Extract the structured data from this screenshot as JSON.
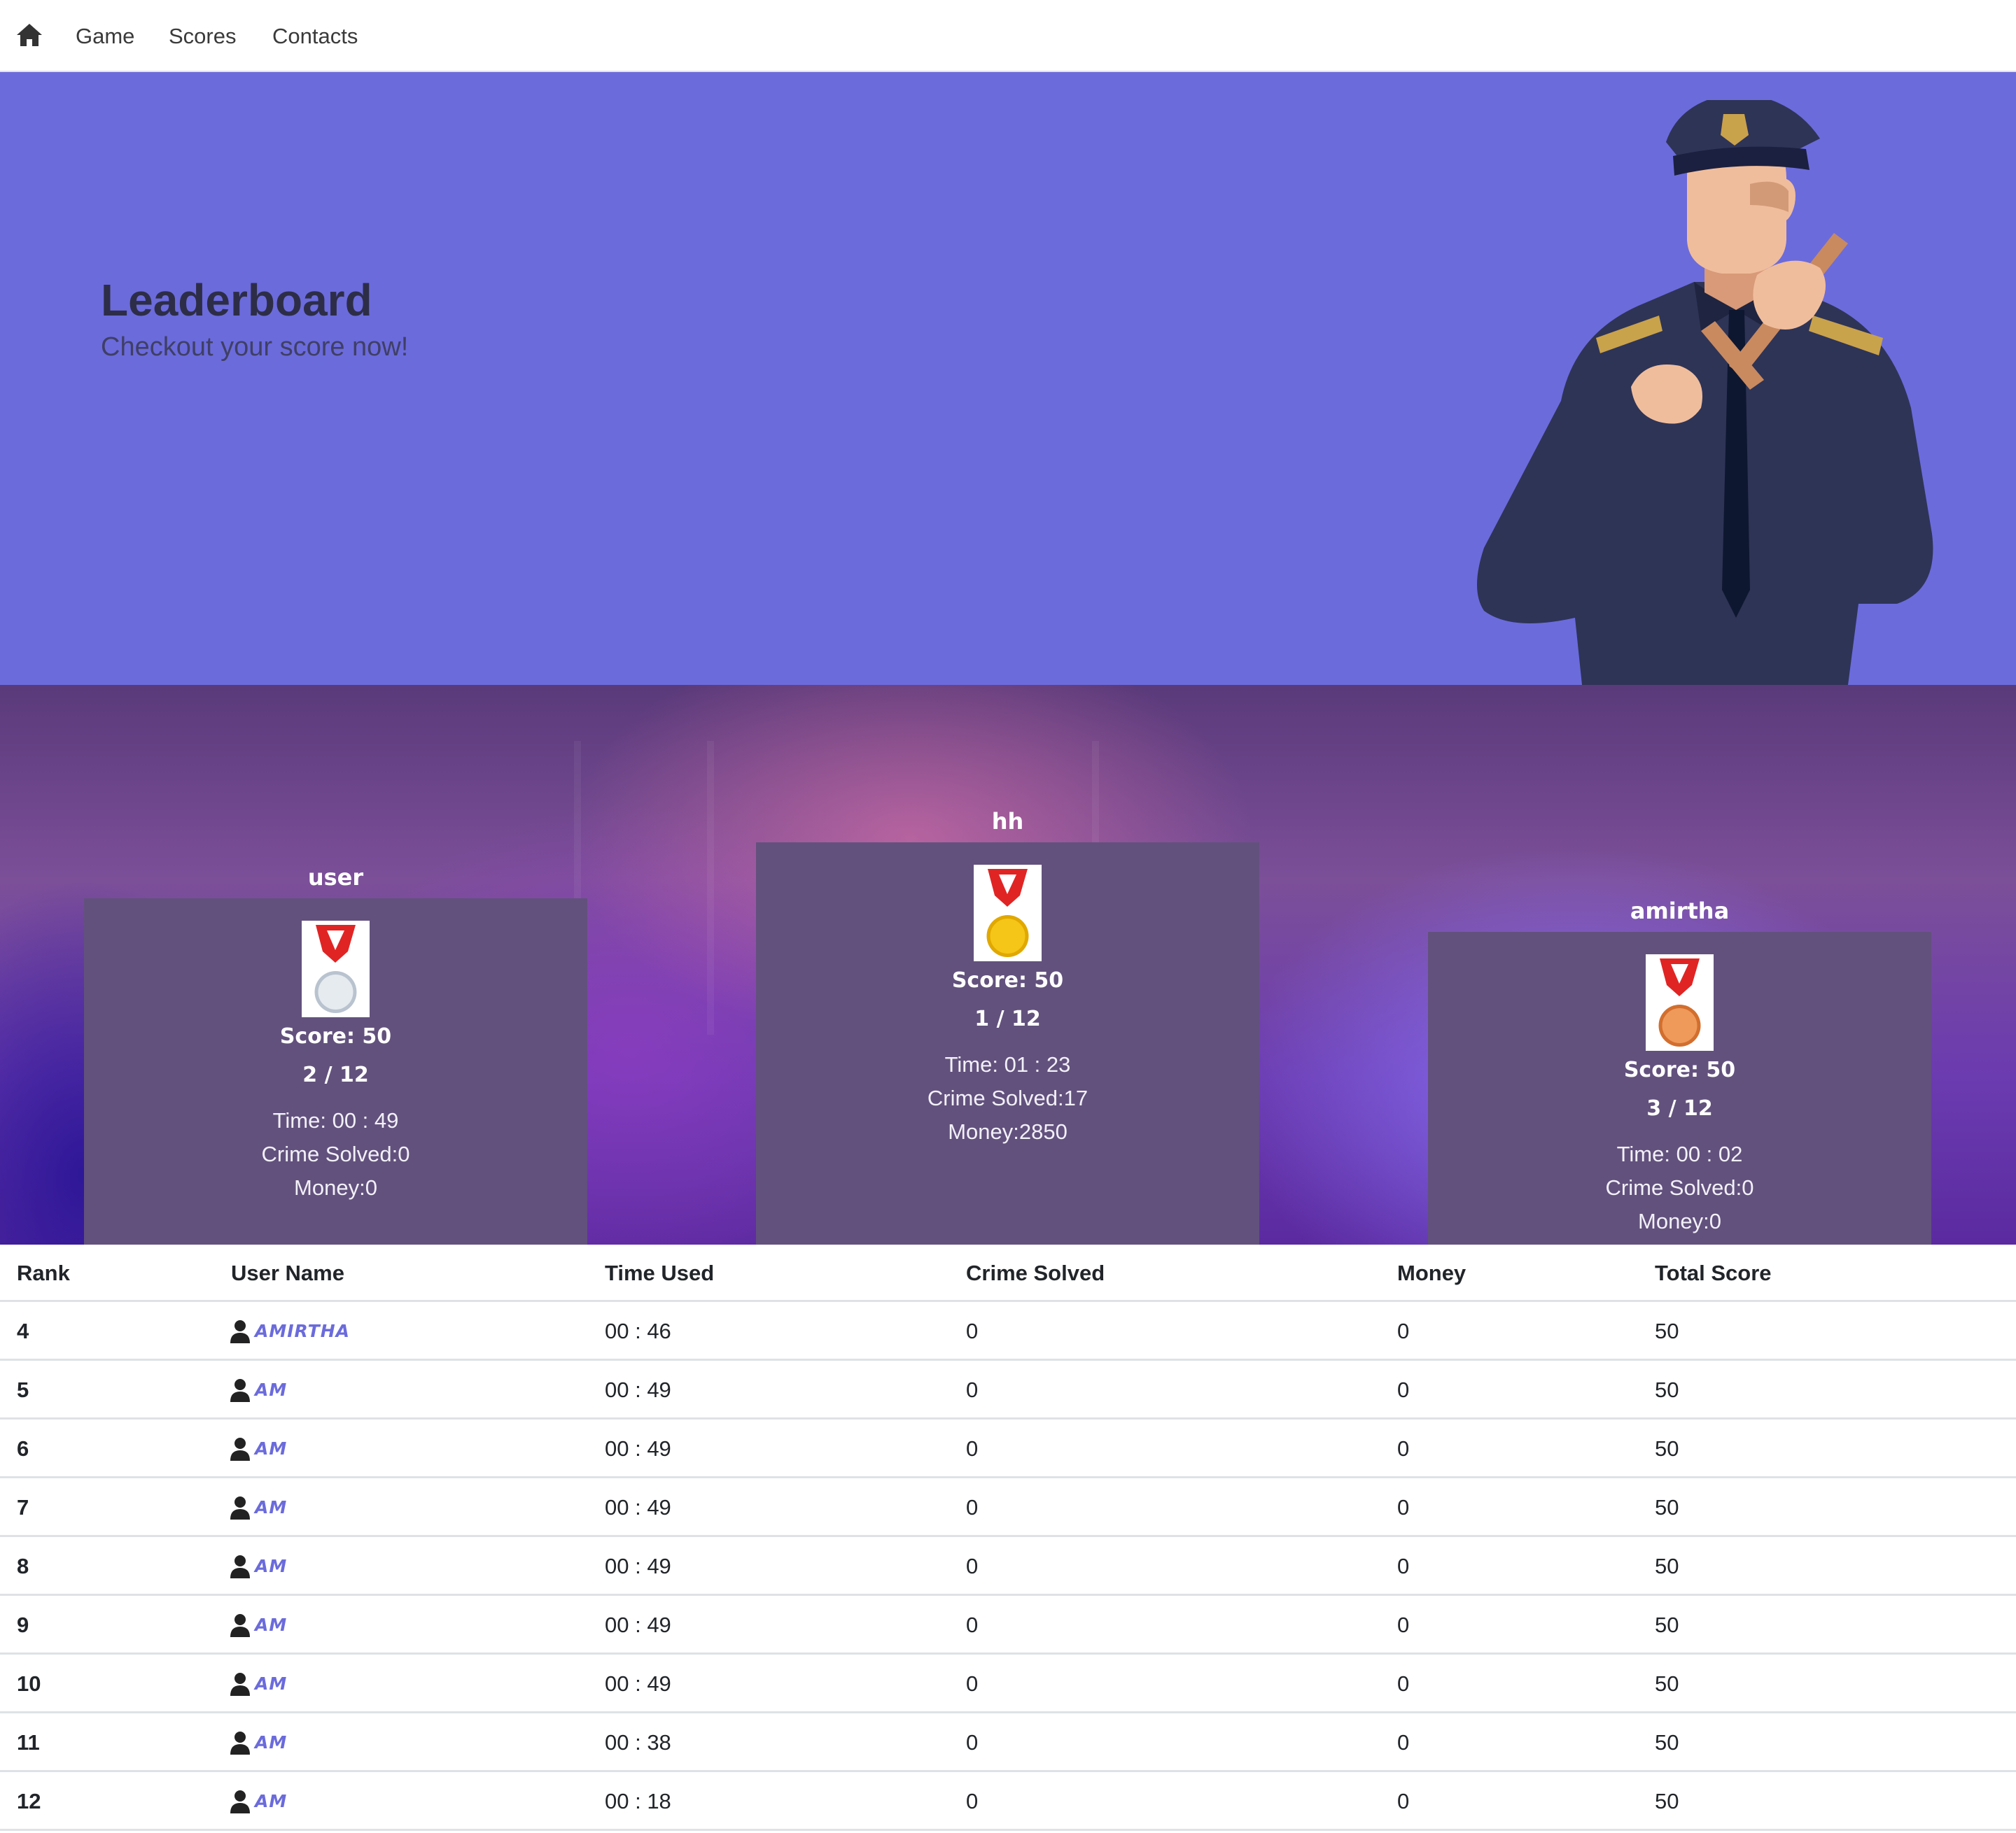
{
  "nav": {
    "home_icon": "home-icon",
    "links": [
      "Game",
      "Scores",
      "Contacts"
    ]
  },
  "hero": {
    "title": "Leaderboard",
    "subtitle": "Checkout your score now!",
    "illustration": "police-officer-illustration",
    "background": "#6b6bdc"
  },
  "podium": [
    {
      "name": "user",
      "medal": "silver-medal-icon",
      "score": "Score: 50",
      "rank": "2 / 12",
      "time": "Time: 00 : 49",
      "crime": "Crime Solved:0",
      "money": "Money:0"
    },
    {
      "name": "hh",
      "medal": "gold-medal-icon",
      "score": "Score: 50",
      "rank": "1 / 12",
      "time": "Time: 01 : 23",
      "crime": "Crime Solved:17",
      "money": "Money:2850"
    },
    {
      "name": "amirtha",
      "medal": "bronze-medal-icon",
      "score": "Score: 50",
      "rank": "3 / 12",
      "time": "Time: 00 : 02",
      "crime": "Crime Solved:0",
      "money": "Money:0"
    }
  ],
  "table": {
    "headers": [
      "Rank",
      "User Name",
      "Time Used",
      "Crime Solved",
      "Money",
      "Total Score"
    ],
    "user_icon": "user-icon",
    "rows": [
      {
        "rank": "4",
        "user": "AMIRTHA",
        "time": "00 : 46",
        "crime": "0",
        "money": "0",
        "score": "50"
      },
      {
        "rank": "5",
        "user": "AM",
        "time": "00 : 49",
        "crime": "0",
        "money": "0",
        "score": "50"
      },
      {
        "rank": "6",
        "user": "AM",
        "time": "00 : 49",
        "crime": "0",
        "money": "0",
        "score": "50"
      },
      {
        "rank": "7",
        "user": "AM",
        "time": "00 : 49",
        "crime": "0",
        "money": "0",
        "score": "50"
      },
      {
        "rank": "8",
        "user": "AM",
        "time": "00 : 49",
        "crime": "0",
        "money": "0",
        "score": "50"
      },
      {
        "rank": "9",
        "user": "AM",
        "time": "00 : 49",
        "crime": "0",
        "money": "0",
        "score": "50"
      },
      {
        "rank": "10",
        "user": "AM",
        "time": "00 : 49",
        "crime": "0",
        "money": "0",
        "score": "50"
      },
      {
        "rank": "11",
        "user": "AM",
        "time": "00 : 38",
        "crime": "0",
        "money": "0",
        "score": "50"
      },
      {
        "rank": "12",
        "user": "AM",
        "time": "00 : 18",
        "crime": "0",
        "money": "0",
        "score": "50"
      }
    ]
  },
  "colors": {
    "accent": "#6b6bdc",
    "card": "#62517d",
    "gold": "#f5c518",
    "silver": "#dfe4ea",
    "bronze": "#e8894a",
    "ribbon": "#e02424"
  }
}
